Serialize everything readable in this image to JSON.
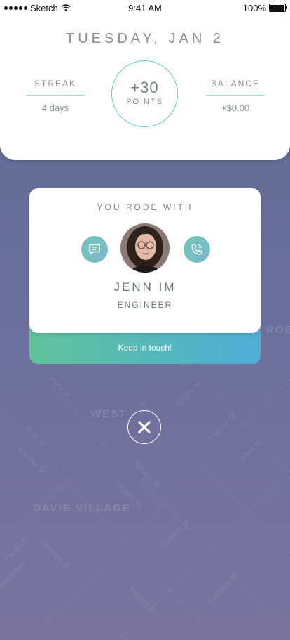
{
  "status_bar": {
    "carrier": "Sketch",
    "time": "9:41 AM",
    "battery": "100%"
  },
  "header": {
    "date": "TUESDAY, JAN 2",
    "streak": {
      "label": "STREAK",
      "value": "4 days"
    },
    "points": {
      "value": "+30",
      "label": "POINTS"
    },
    "balance": {
      "label": "BALANCE",
      "value": "+$0.00"
    }
  },
  "rider_card": {
    "title": "YOU RODE WITH",
    "name": "JENN IM",
    "occupation": "ENGINEER",
    "message_icon": "chat-bubble-icon",
    "call_icon": "phone-icon",
    "cta_label": "Keep in touch!"
  },
  "map_labels": {
    "west_end": "WEST",
    "davie_village": "DAVIE VILLAGE",
    "robson": "ROBS",
    "streets": [
      "Thurlow St",
      "Nelson St",
      "Burrard St",
      "Hornby St",
      "Haro St",
      "Harwood St",
      "Pacific St",
      "Comox St",
      "Barclay St",
      "Granville St",
      "Jervis St",
      "Smithe St",
      "Bute St",
      "Beach Ave"
    ]
  },
  "close_icon": "close-icon",
  "colors": {
    "accent_teal": "#5fd0c2",
    "cta_start": "#60c39a",
    "cta_end": "#4fadd7",
    "map_bg": "#6a6f9b"
  }
}
